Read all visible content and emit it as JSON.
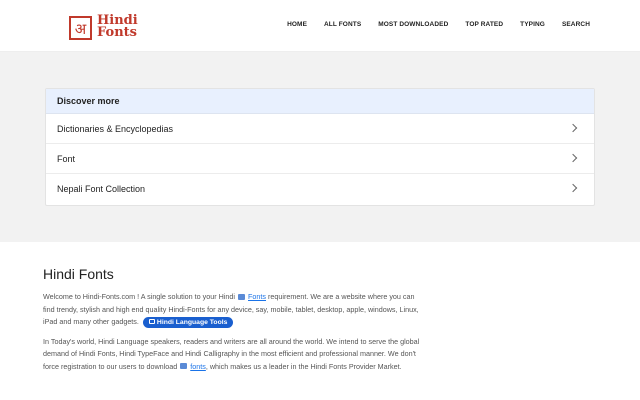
{
  "header": {
    "logo": {
      "glyph": "अ",
      "line1": "Hindi",
      "line2": "Fonts"
    },
    "nav": [
      "HOME",
      "ALL FONTS",
      "MOST DOWNLOADED",
      "TOP RATED",
      "TYPING",
      "SEARCH"
    ]
  },
  "discover": {
    "title": "Discover more",
    "items": [
      "Dictionaries & Encyclopedias",
      "Font",
      "Nepali Font Collection"
    ]
  },
  "article": {
    "title": "Hindi Fonts",
    "p1": {
      "before": "Welcome to Hindi-Fonts.com ! A single solution to your Hindi",
      "link": "Fonts",
      "after": "requirement. We are a website where you can find trendy, stylish and high end quality Hindi-Fonts for any device, say, mobile, tablet, desktop, apple, windows, Linux, iPad and many other gadgets.",
      "button": "Hindi Language Tools"
    },
    "p2": {
      "before": "In Today's world, Hindi Language speakers, readers and writers are all around the world. We intend to serve the global demand of Hindi Fonts, Hindi TypeFace and Hindi Calligraphy in the most efficient and professional manner. We don't force registration to our users to download",
      "link": "fonts",
      "after": ", which makes us a leader in the Hindi Fonts Provider Market."
    }
  },
  "colors": {
    "brand": "#c0392b",
    "accent": "#1a5fcf",
    "band": "#f2f2f2"
  }
}
